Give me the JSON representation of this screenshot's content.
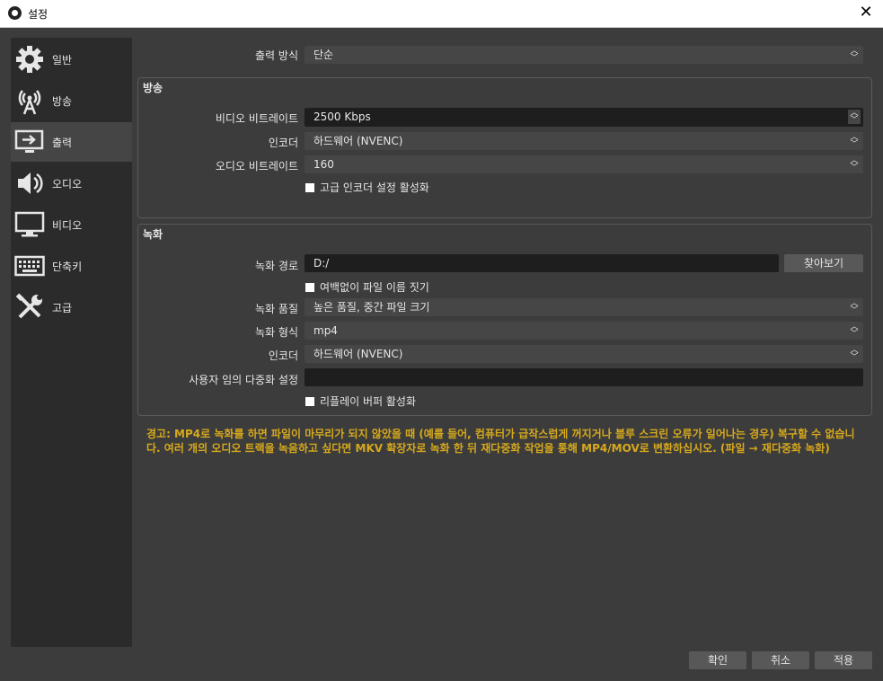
{
  "window": {
    "title": "설정",
    "close_label": "✕"
  },
  "sidebar": {
    "items": [
      {
        "label": "일반",
        "icon": "gear-icon"
      },
      {
        "label": "방송",
        "icon": "broadcast-icon"
      },
      {
        "label": "출력",
        "icon": "output-icon"
      },
      {
        "label": "오디오",
        "icon": "speaker-icon"
      },
      {
        "label": "비디오",
        "icon": "monitor-icon"
      },
      {
        "label": "단축키",
        "icon": "keyboard-icon"
      },
      {
        "label": "고급",
        "icon": "tools-icon"
      }
    ],
    "active_index": 2
  },
  "output_mode": {
    "label": "출력 방식",
    "value": "단순"
  },
  "streaming": {
    "title": "방송",
    "video_bitrate": {
      "label": "비디오 비트레이트",
      "value": "2500 Kbps"
    },
    "encoder": {
      "label": "인코더",
      "value": "하드웨어 (NVENC)"
    },
    "audio_bitrate": {
      "label": "오디오 비트레이트",
      "value": "160"
    },
    "advanced_encoder": {
      "label": "고급 인코더 설정 활성화",
      "checked": false
    }
  },
  "recording": {
    "title": "녹화",
    "path": {
      "label": "녹화 경로",
      "value": "D:/"
    },
    "browse_label": "찾아보기",
    "no_space": {
      "label": "여백없이 파일 이름 짓기",
      "checked": false
    },
    "quality": {
      "label": "녹화 품질",
      "value": "높은 품질, 중간 파일 크기"
    },
    "format": {
      "label": "녹화 형식",
      "value": "mp4"
    },
    "encoder": {
      "label": "인코더",
      "value": "하드웨어 (NVENC)"
    },
    "muxer": {
      "label": "사용자 임의 다중화 설정",
      "value": ""
    },
    "replay_buffer": {
      "label": "리플레이 버퍼 활성화",
      "checked": false
    }
  },
  "warning": "경고: MP4로 녹화를 하면 파일이 마무리가 되지 않았을 때 (예를 들어, 컴퓨터가 급작스럽게 꺼지거나 블루 스크린 오류가 일어나는 경우) 복구할 수 없습니다. 여러 개의 오디오 트랙을 녹음하고 싶다면 MKV 확장자로 녹화 한 뒤 재다중화 작업을 통해 MP4/MOV로 변환하십시오. (파일 → 재다중화 녹화)",
  "footer": {
    "ok": "확인",
    "cancel": "취소",
    "apply": "적용"
  },
  "colors": {
    "warning": "#d7a91c",
    "background": "#3c3c3c",
    "sidebar": "#2b2b2b"
  }
}
